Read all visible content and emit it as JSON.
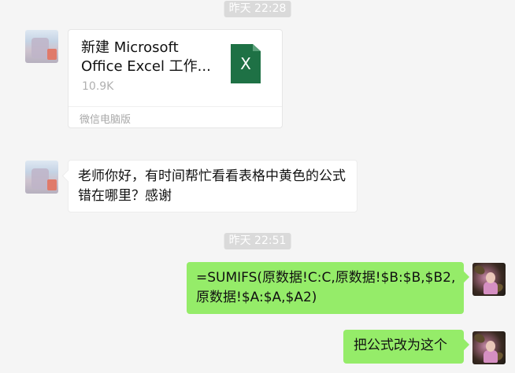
{
  "timestamps": [
    "昨天 22:28",
    "昨天 22:51"
  ],
  "file_message": {
    "name": "新建 Microsoft Office Excel 工作...",
    "size": "10.9K",
    "source": "微信电脑版",
    "icon_letter": "X",
    "icon": "excel-file-icon",
    "icon_color": "#1e7145"
  },
  "messages": [
    {
      "side": "left",
      "text": "老师你好，有时间帮忙看看表格中黄色的公式错在哪里？感谢"
    },
    {
      "side": "right",
      "text": "=SUMIFS(原数据!C:C,原数据!$B:$B,$B2,原数据!$A:$A,$A2)"
    },
    {
      "side": "right",
      "text": "把公式改为这个"
    }
  ],
  "colors": {
    "background": "#f5f5f5",
    "bubble_left": "#ffffff",
    "bubble_right": "#95ec69",
    "timestamp_bg": "#dadada"
  }
}
